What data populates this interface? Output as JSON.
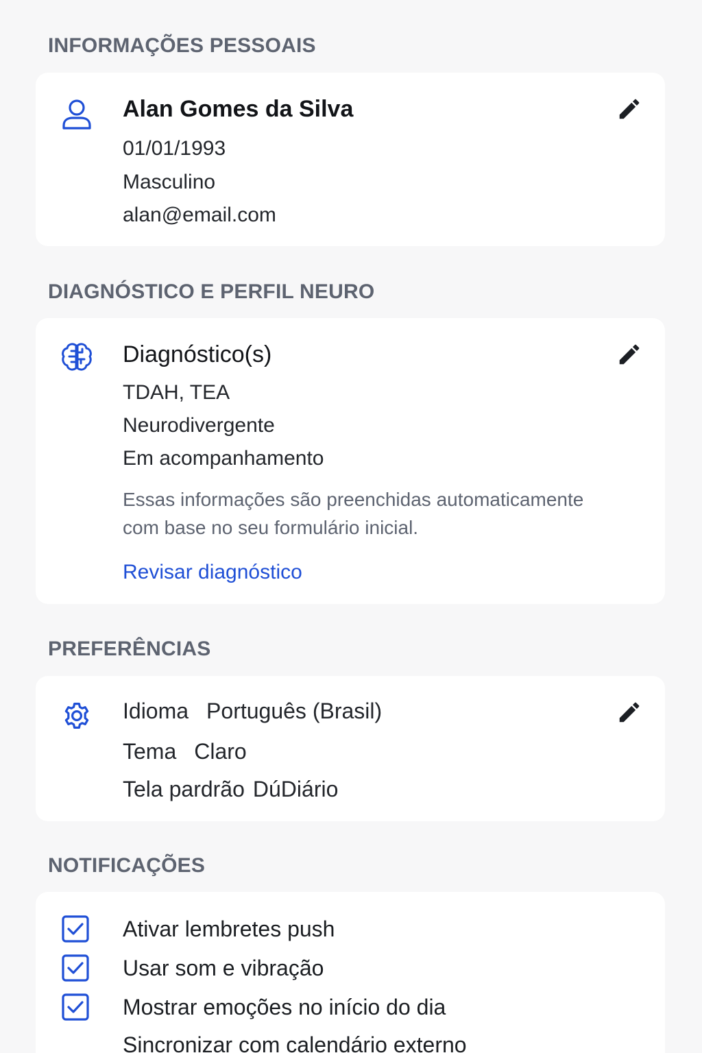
{
  "personal": {
    "section_title": "INFORMAÇÕES PESSOAIS",
    "icon": "user-icon",
    "name": "Alan Gomes da Silva",
    "birth_date": "01/01/1993",
    "gender": "Masculino",
    "email": "alan@email.com"
  },
  "diagnosis": {
    "section_title": "DIAGNÓSTICO E PERFIL NEURO",
    "icon": "brain-icon",
    "title": "Diagnóstico(s)",
    "diagnoses": "TDAH, TEA",
    "profile": "Neurodivergente",
    "status": "Em acompanhamento",
    "note_line1": "Essas informações são preenchidas automaticamente",
    "note_line2": "com base no seu formulário inicial.",
    "review_link": "Revisar diagnóstico"
  },
  "preferences": {
    "section_title": "PREFERÊNCIAS",
    "icon": "gear-icon",
    "language_label": "Idioma",
    "language_value": "Português (Brasil)",
    "theme_label": "Tema",
    "theme_value": "Claro",
    "default_screen_label": "Tela pardrão",
    "default_screen_value": "DúDiário"
  },
  "notifications": {
    "section_title": "NOTIFICAÇÕES",
    "items": [
      {
        "label": "Ativar lembretes push",
        "checked": true
      },
      {
        "label": "Usar som e vibração",
        "checked": true
      },
      {
        "label": "Mostrar emoções no início do dia",
        "checked": true
      },
      {
        "label": "Sincronizar com calendário externo",
        "checked": false
      }
    ]
  },
  "colors": {
    "accent": "#1f4fd6",
    "background": "#f7f7f8",
    "card": "#ffffff",
    "section_title": "#5d6370"
  }
}
